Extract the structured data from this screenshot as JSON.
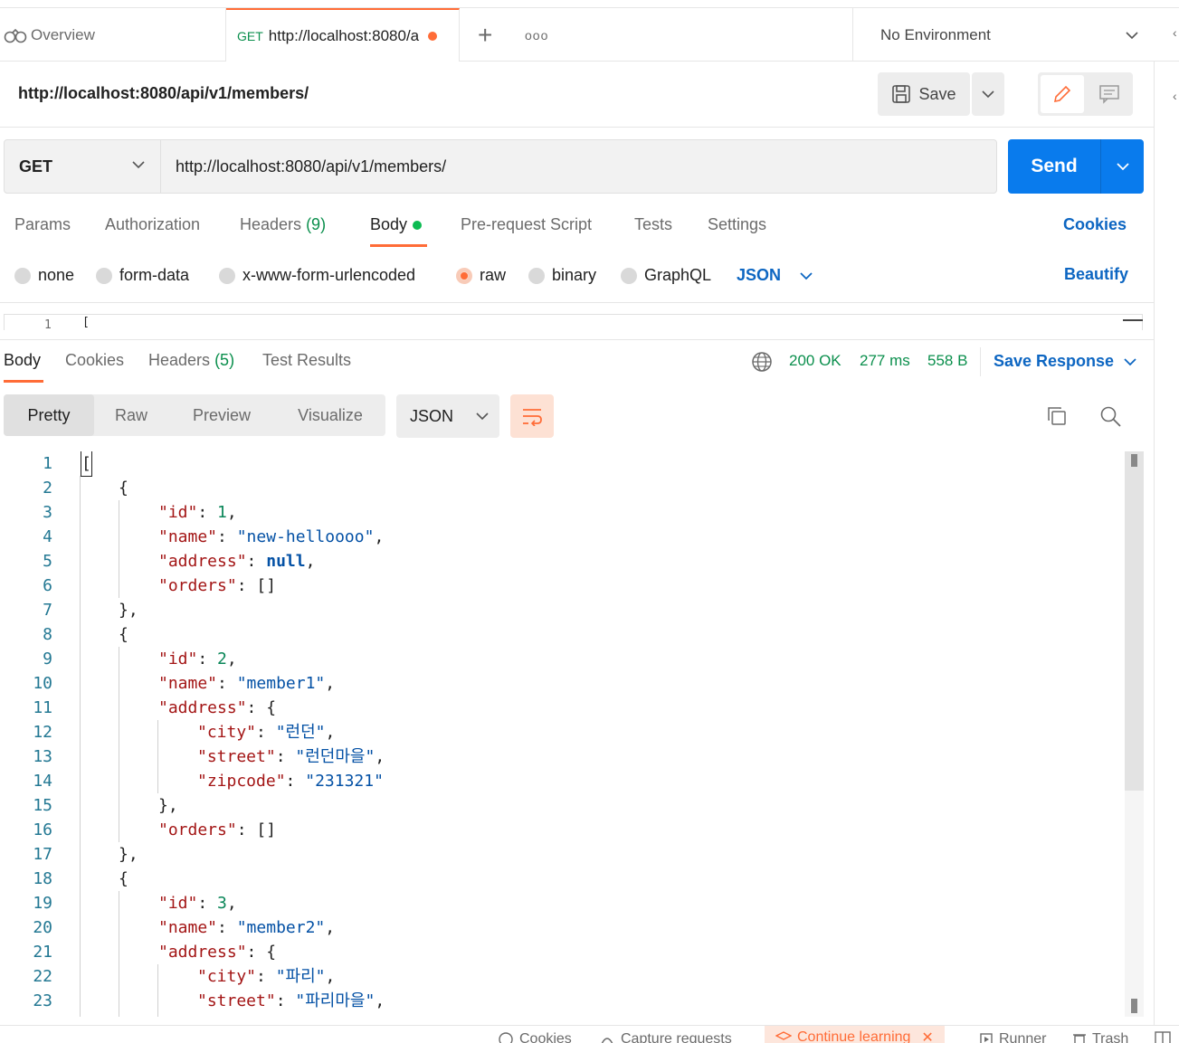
{
  "tabs": {
    "overview": "Overview",
    "active_method": "GET",
    "active_url": "http://localhost:8080/a",
    "environment": "No Environment"
  },
  "request": {
    "title": "http://localhost:8080/api/v1/members/",
    "save_label": "Save",
    "method": "GET",
    "url": "http://localhost:8080/api/v1/members/",
    "send_label": "Send"
  },
  "request_tabs": {
    "params": "Params",
    "authorization": "Authorization",
    "headers": "Headers",
    "headers_count": "(9)",
    "body": "Body",
    "prerequest": "Pre-request Script",
    "tests": "Tests",
    "settings": "Settings",
    "cookies": "Cookies"
  },
  "body_types": {
    "none": "none",
    "form_data": "form-data",
    "urlencoded": "x-www-form-urlencoded",
    "raw": "raw",
    "binary": "binary",
    "graphql": "GraphQL",
    "format": "JSON",
    "beautify": "Beautify",
    "selected": "raw"
  },
  "request_editor": {
    "line1_number": "1",
    "line1_text": "["
  },
  "response": {
    "tabs": {
      "body": "Body",
      "cookies": "Cookies",
      "headers": "Headers",
      "headers_count": "(5)",
      "test_results": "Test Results"
    },
    "status": "200 OK",
    "time": "277 ms",
    "size": "558 B",
    "save_response": "Save Response",
    "views": {
      "pretty": "Pretty",
      "raw": "Raw",
      "preview": "Preview",
      "visualize": "Visualize",
      "format": "JSON"
    }
  },
  "code_lines": [
    "1",
    "2",
    "3",
    "4",
    "5",
    "6",
    "7",
    "8",
    "9",
    "10",
    "11",
    "12",
    "13",
    "14",
    "15",
    "16",
    "17",
    "18",
    "19",
    "20",
    "21",
    "22",
    "23"
  ],
  "code_text": {
    "l1": "[",
    "l2": "{",
    "l3_key": "\"id\"",
    "l3_val": "1",
    "l4_key": "\"name\"",
    "l4_val": "\"new-helloooo\"",
    "l5_key": "\"address\"",
    "l5_val": "null",
    "l6_key": "\"orders\"",
    "l6_val": "[]",
    "l7": "},",
    "l8": "{",
    "l9_key": "\"id\"",
    "l9_val": "2",
    "l10_key": "\"name\"",
    "l10_val": "\"member1\"",
    "l11_key": "\"address\"",
    "l11_val": "{",
    "l12_key": "\"city\"",
    "l12_val": "\"런던\"",
    "l13_key": "\"street\"",
    "l13_val": "\"런던마을\"",
    "l14_key": "\"zipcode\"",
    "l14_val": "\"231321\"",
    "l15": "},",
    "l16_key": "\"orders\"",
    "l16_val": "[]",
    "l17": "},",
    "l18": "{",
    "l19_key": "\"id\"",
    "l19_val": "3",
    "l20_key": "\"name\"",
    "l20_val": "\"member2\"",
    "l21_key": "\"address\"",
    "l21_val": "{",
    "l22_key": "\"city\"",
    "l22_val": "\"파리\"",
    "l23_key": "\"street\"",
    "l23_val": "\"파리마을\""
  },
  "footer": {
    "cookies": "Cookies",
    "capture": "Capture requests",
    "continue": "Continue learning",
    "runner": "Runner",
    "trash": "Trash"
  },
  "colors": {
    "accent": "#ff6c37",
    "send": "#097bed",
    "link": "#0d66c2",
    "status_ok": "#0b8f4d"
  }
}
